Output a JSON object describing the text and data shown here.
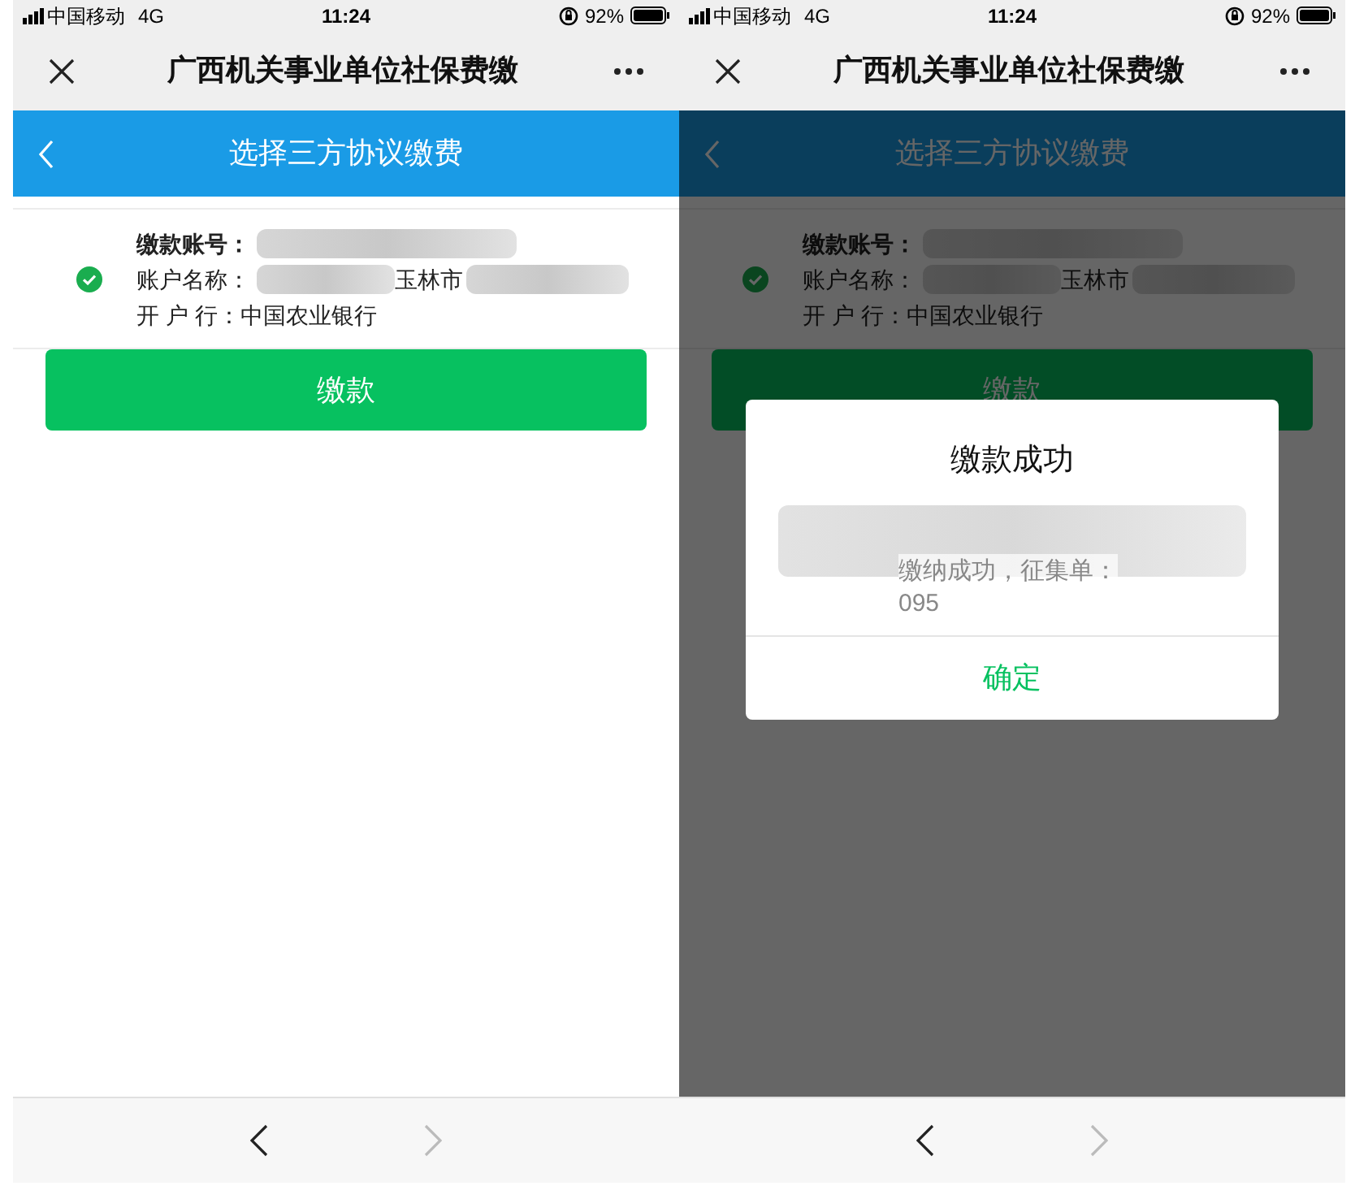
{
  "phones": [
    {
      "status_bar": {
        "carrier": "中国移动",
        "network": "4G",
        "time": "11:24",
        "battery": "92%"
      },
      "nav_title": "广西机关事业单位社保费缴",
      "header_title": "选择三方协议缴费",
      "account": {
        "selected": true,
        "lines": [
          {
            "label": "缴款账号："
          },
          {
            "label": "账户名称：",
            "value_parts": [
              "玉林市"
            ]
          },
          {
            "label": "开 户 行：",
            "value_parts": [
              "中国农业银行"
            ]
          }
        ]
      },
      "pay_button": "缴款",
      "toolbar": {
        "back_disabled": false,
        "forward_disabled": true
      }
    },
    {
      "status_bar": {
        "carrier": "中国移动",
        "network": "4G",
        "time": "11:24",
        "battery": "92%"
      },
      "nav_title": "广西机关事业单位社保费缴",
      "header_title": "选择三方协议缴费",
      "account": {
        "selected": true,
        "lines": [
          {
            "label": "缴款账号："
          },
          {
            "label": "账户名称：",
            "value_parts": [
              "玉林市"
            ]
          },
          {
            "label": "开 户 行：",
            "value_parts": [
              "中国农业银行"
            ]
          }
        ]
      },
      "pay_button": "缴款",
      "toolbar": {
        "back_disabled": false,
        "forward_disabled": true
      },
      "dialog": {
        "title": "缴款成功",
        "message_lines": [
          "缴纳成功，征集单：",
          "095"
        ],
        "button": "确定"
      }
    }
  ]
}
